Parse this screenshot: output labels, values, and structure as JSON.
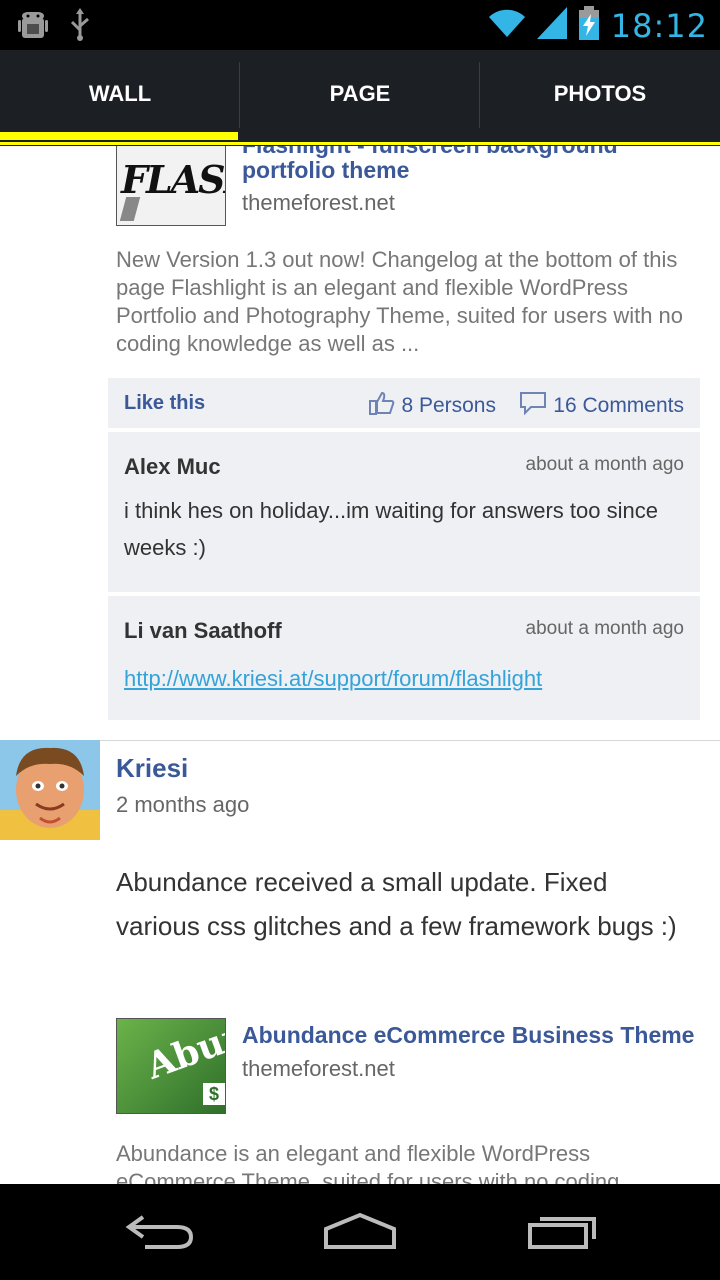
{
  "status_bar": {
    "time": "18:12",
    "icons": [
      "android-debug-icon",
      "usb-icon",
      "wifi-icon",
      "signal-icon",
      "battery-charging-icon"
    ]
  },
  "tabs": [
    {
      "label": "WALL",
      "selected": true
    },
    {
      "label": "PAGE",
      "selected": false
    },
    {
      "label": "PHOTOS",
      "selected": false
    }
  ],
  "post1": {
    "link_title_partial": "Flashlight - fullscreen background",
    "link_title": "portfolio theme",
    "link_domain": "themeforest.net",
    "thumb_text": "FLASHL",
    "description": "New Version 1.3 out now! Changelog at the bottom of this page Flashlight is an elegant and flexible WordPress Portfolio and Photography Theme, suited for users with no coding knowledge as well as ...",
    "like_label": "Like this",
    "persons": "8 Persons",
    "comments": "16 Comments",
    "comment_list": [
      {
        "author": "Alex Muc",
        "time": "about a month ago",
        "text": "i think hes on holiday...im waiting for answers too since weeks :)"
      },
      {
        "author": "Li van Saathoff",
        "time": "about a month ago",
        "link": "http://www.kriesi.at/support/forum/flashlight"
      }
    ]
  },
  "post2": {
    "author": "Kriesi",
    "time": "2 months ago",
    "text": "Abundance received a small update. Fixed various css glitches and a few framework bugs :)",
    "link_title": "Abundance eCommerce Business Theme",
    "link_domain": "themeforest.net",
    "thumb_text": "Abun",
    "description": "Abundance is an elegant and flexible WordPress eCommerce Theme, suited for users with no coding"
  },
  "colors": {
    "accent_blue": "#3b5998",
    "tab_indicator": "#ffff00",
    "clock": "#33b5e5",
    "link": "#33a3d9"
  }
}
